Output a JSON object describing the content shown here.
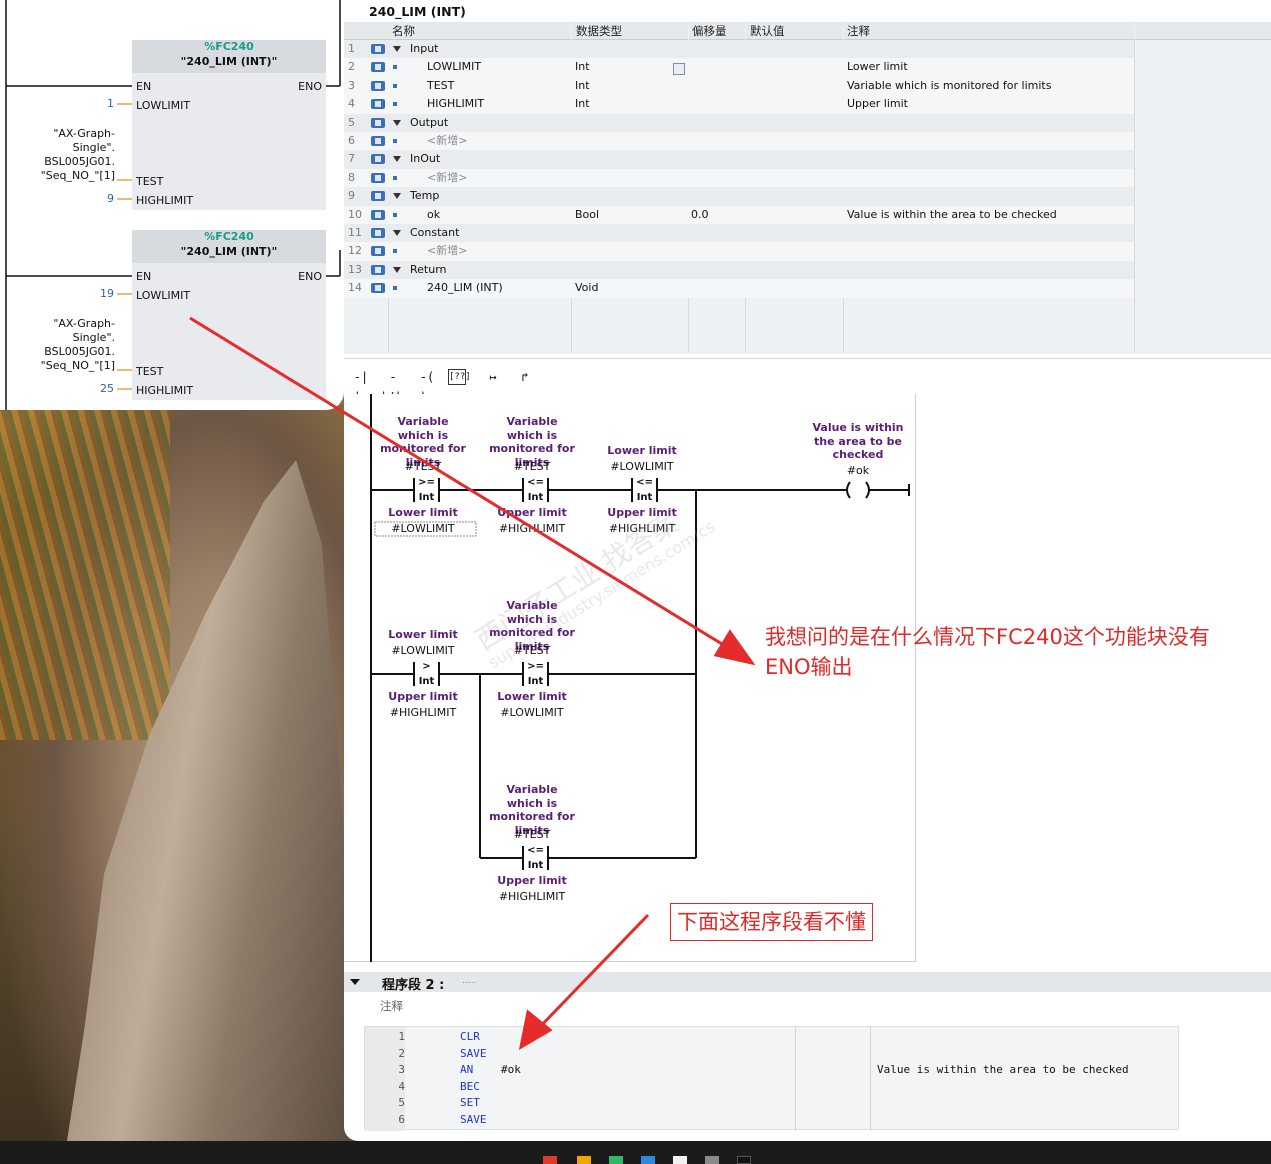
{
  "fbd": {
    "blocks": [
      {
        "number": "%FC240",
        "name": "\"240_LIM (INT)\"",
        "en": "EN",
        "eno": "ENO",
        "pins": [
          "LOWLIMIT",
          "TEST",
          "HIGHLIMIT"
        ],
        "lowlimit": "1",
        "test_tag": [
          "\"AX-Graph-",
          "Single\".",
          "BSL005JG01.",
          "\"Seq_NO_\"[1]"
        ],
        "highlimit": "9"
      },
      {
        "number": "%FC240",
        "name": "\"240_LIM (INT)\"",
        "en": "EN",
        "eno": "ENO",
        "pins": [
          "LOWLIMIT",
          "TEST",
          "HIGHLIMIT"
        ],
        "lowlimit": "19",
        "test_tag": [
          "\"AX-Graph-",
          "Single\".",
          "BSL005JG01.",
          "\"Seq_NO_\"[1]"
        ],
        "highlimit": "25"
      }
    ]
  },
  "interface": {
    "title": "240_LIM (INT)",
    "columns": [
      "名称",
      "数据类型",
      "偏移量",
      "默认值",
      "注释"
    ],
    "rows": [
      {
        "n": "1",
        "name": "Input",
        "kind": "section",
        "type": "",
        "offset": "",
        "comment": ""
      },
      {
        "n": "2",
        "name": "LOWLIMIT",
        "kind": "item",
        "type": "Int",
        "offset": "",
        "comment": "Lower limit"
      },
      {
        "n": "3",
        "name": "TEST",
        "kind": "item",
        "type": "Int",
        "offset": "",
        "comment": "Variable which is monitored for limits"
      },
      {
        "n": "4",
        "name": "HIGHLIMIT",
        "kind": "item",
        "type": "Int",
        "offset": "",
        "comment": "Upper limit"
      },
      {
        "n": "5",
        "name": "Output",
        "kind": "section",
        "type": "",
        "offset": "",
        "comment": ""
      },
      {
        "n": "6",
        "name": "<新增>",
        "kind": "new",
        "type": "",
        "offset": "",
        "comment": ""
      },
      {
        "n": "7",
        "name": "InOut",
        "kind": "section",
        "type": "",
        "offset": "",
        "comment": ""
      },
      {
        "n": "8",
        "name": "<新增>",
        "kind": "new",
        "type": "",
        "offset": "",
        "comment": ""
      },
      {
        "n": "9",
        "name": "Temp",
        "kind": "section",
        "type": "",
        "offset": "",
        "comment": ""
      },
      {
        "n": "10",
        "name": "ok",
        "kind": "item",
        "type": "Bool",
        "offset": "0.0",
        "comment": "Value is within the area to be checked"
      },
      {
        "n": "11",
        "name": "Constant",
        "kind": "section",
        "type": "",
        "offset": "",
        "comment": ""
      },
      {
        "n": "12",
        "name": "<新增>",
        "kind": "new",
        "type": "",
        "offset": "",
        "comment": ""
      },
      {
        "n": "13",
        "name": "Return",
        "kind": "section",
        "type": "",
        "offset": "",
        "comment": ""
      },
      {
        "n": "14",
        "name": "240_LIM (INT)",
        "kind": "item",
        "type": "Void",
        "offset": "",
        "comment": ""
      }
    ]
  },
  "toolbar": {
    "items": [
      "-| |-",
      "-|/|-",
      "-( )-",
      "[??]",
      "↦",
      "↱"
    ]
  },
  "ladder": {
    "labels": {
      "var_monitored": "Variable which is monitored for limits",
      "lower_limit": "Lower limit",
      "upper_limit": "Upper limit",
      "value_within": "Value is within the area to be checked"
    },
    "operands": {
      "test": "#TEST",
      "low": "#LOWLIMIT",
      "high": "#HIGHLIMIT",
      "ok": "#ok"
    },
    "compare": {
      "ge": ">=",
      "le": "<=",
      "gt": ">",
      "int": "Int"
    }
  },
  "segment2": {
    "title": "程序段 2 :",
    "dots": ".....",
    "comment_label": "注释",
    "lines": [
      {
        "n": "1",
        "op": "CLR",
        "arg": "",
        "comment": ""
      },
      {
        "n": "2",
        "op": "SAVE",
        "arg": "",
        "comment": ""
      },
      {
        "n": "3",
        "op": "AN",
        "arg": "#ok",
        "comment": "Value is within the area to be checked"
      },
      {
        "n": "4",
        "op": "BEC",
        "arg": "",
        "comment": ""
      },
      {
        "n": "5",
        "op": "SET",
        "arg": "",
        "comment": ""
      },
      {
        "n": "6",
        "op": "SAVE",
        "arg": "",
        "comment": ""
      }
    ]
  },
  "annotations": {
    "question": "我想问的是在什么情况下FC240这个功能块没有ENO输出",
    "note": "下面这程序段看不懂",
    "color": "#e02a2a"
  },
  "watermark": {
    "line1": "西门子工业 找答案",
    "line2": "support.industry.siemens.com/cs"
  }
}
